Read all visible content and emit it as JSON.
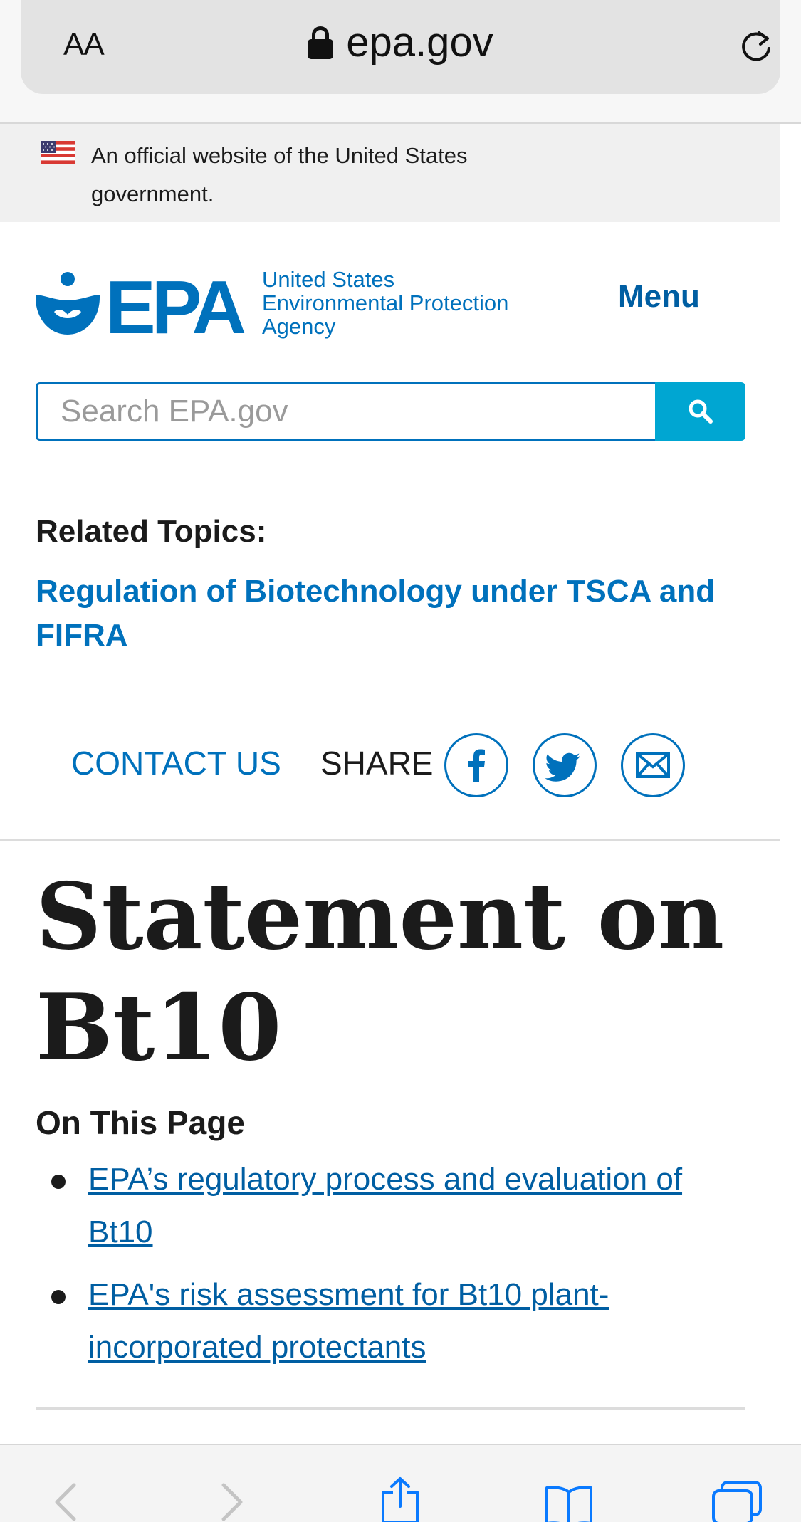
{
  "browser": {
    "text_size_label": "AA",
    "url": "epa.gov"
  },
  "gov_banner": {
    "text": "An official website of the United States government."
  },
  "header": {
    "logo_text": "EPA",
    "agency_name_lines": [
      "United States",
      "Environmental Protection",
      "Agency"
    ],
    "menu_label": "Menu"
  },
  "search": {
    "placeholder": "Search EPA.gov"
  },
  "related_topics": {
    "heading": "Related Topics:",
    "link": "Regulation of Biotechnology under TSCA and FIFRA"
  },
  "actions": {
    "contact_label": "CONTACT US",
    "share_label": "SHARE",
    "share_icons": [
      "facebook-icon",
      "twitter-icon",
      "email-icon"
    ]
  },
  "article": {
    "title": "Statement on Bt10",
    "on_this_page_heading": "On This Page",
    "toc": [
      "EPA’s regulatory process and evaluation of Bt10",
      "EPA's risk assessment for Bt10 plant-incorporated protectants"
    ]
  },
  "colors": {
    "link_blue": "#0071bc",
    "search_button": "#00a6d2",
    "heading_text": "#1b1b1b"
  }
}
